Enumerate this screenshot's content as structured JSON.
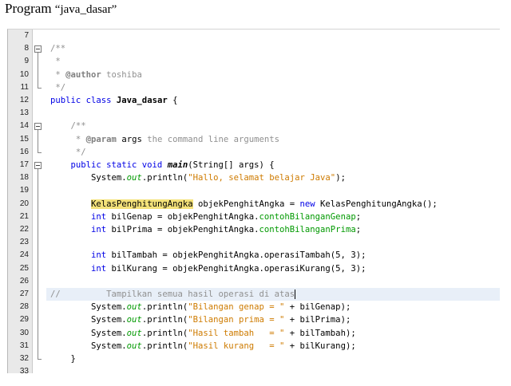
{
  "document": {
    "title_prefix": "Program",
    "title_quoted": "“java_dasar”"
  },
  "editor": {
    "lines": [
      {
        "num": "7",
        "parts": []
      },
      {
        "num": "8",
        "fold": "open",
        "parts": [
          {
            "t": "/**",
            "c": "c"
          }
        ]
      },
      {
        "num": "9",
        "parts": [
          {
            "t": " *",
            "c": "c"
          }
        ]
      },
      {
        "num": "10",
        "parts": [
          {
            "t": " * ",
            "c": "c"
          },
          {
            "t": "@author",
            "c": "ctag"
          },
          {
            "t": " toshiba",
            "c": "c"
          }
        ]
      },
      {
        "num": "11",
        "fold": "end",
        "parts": [
          {
            "t": " */",
            "c": "c"
          }
        ]
      },
      {
        "num": "12",
        "parts": [
          {
            "t": "public class ",
            "c": "kw"
          },
          {
            "t": "Java_dasar",
            "c": "cls"
          },
          {
            "t": " {",
            "c": ""
          }
        ]
      },
      {
        "num": "13",
        "parts": []
      },
      {
        "num": "14",
        "fold": "open",
        "parts": [
          {
            "t": "    /**",
            "c": "c"
          }
        ]
      },
      {
        "num": "15",
        "parts": [
          {
            "t": "     * ",
            "c": "c"
          },
          {
            "t": "@param",
            "c": "ctag"
          },
          {
            "t": " args",
            "c": ""
          },
          {
            "t": " the command line arguments",
            "c": "c"
          }
        ]
      },
      {
        "num": "16",
        "fold": "end",
        "parts": [
          {
            "t": "     */",
            "c": "c"
          }
        ]
      },
      {
        "num": "17",
        "fold": "open",
        "parts": [
          {
            "t": "    public static void ",
            "c": "kw"
          },
          {
            "t": "main",
            "c": "mth"
          },
          {
            "t": "(String[] args) {",
            "c": ""
          }
        ]
      },
      {
        "num": "18",
        "parts": [
          {
            "t": "        System.",
            "c": ""
          },
          {
            "t": "out",
            "c": "fld"
          },
          {
            "t": ".println(",
            "c": ""
          },
          {
            "t": "\"Hallo, selamat belajar Java\"",
            "c": "str"
          },
          {
            "t": ");",
            "c": ""
          }
        ]
      },
      {
        "num": "19",
        "parts": []
      },
      {
        "num": "20",
        "parts": [
          {
            "t": "        ",
            "c": ""
          },
          {
            "t": "KelasPenghitungAngka",
            "c": "mark"
          },
          {
            "t": " objekPenghitAngka = ",
            "c": ""
          },
          {
            "t": "new",
            "c": "kw"
          },
          {
            "t": " KelasPenghitungAngka();",
            "c": ""
          }
        ]
      },
      {
        "num": "21",
        "parts": [
          {
            "t": "        ",
            "c": ""
          },
          {
            "t": "int",
            "c": "kw"
          },
          {
            "t": " bilGenap = objekPenghitAngka.",
            "c": ""
          },
          {
            "t": "contohBilanganGenap",
            "c": "mcall"
          },
          {
            "t": ";",
            "c": ""
          }
        ]
      },
      {
        "num": "22",
        "parts": [
          {
            "t": "        ",
            "c": ""
          },
          {
            "t": "int",
            "c": "kw"
          },
          {
            "t": " bilPrima = objekPenghitAngka.",
            "c": ""
          },
          {
            "t": "contohBilanganPrima",
            "c": "mcall"
          },
          {
            "t": ";",
            "c": ""
          }
        ]
      },
      {
        "num": "23",
        "parts": []
      },
      {
        "num": "24",
        "parts": [
          {
            "t": "        ",
            "c": ""
          },
          {
            "t": "int",
            "c": "kw"
          },
          {
            "t": " bilTambah = objekPenghitAngka.operasiTambah(5, 3);",
            "c": ""
          }
        ]
      },
      {
        "num": "25",
        "parts": [
          {
            "t": "        ",
            "c": ""
          },
          {
            "t": "int",
            "c": "kw"
          },
          {
            "t": " bilKurang = objekPenghitAngka.operasiKurang(5, 3);",
            "c": ""
          }
        ]
      },
      {
        "num": "26",
        "parts": []
      },
      {
        "num": "27",
        "current": true,
        "parts": [
          {
            "t": "//         Tampilkan semua hasil operasi di atas",
            "c": "c"
          },
          {
            "t": "",
            "c": "caret"
          }
        ]
      },
      {
        "num": "28",
        "parts": [
          {
            "t": "        System.",
            "c": ""
          },
          {
            "t": "out",
            "c": "fld"
          },
          {
            "t": ".println(",
            "c": ""
          },
          {
            "t": "\"Bilangan genap = \"",
            "c": "str"
          },
          {
            "t": " + bilGenap);",
            "c": ""
          }
        ]
      },
      {
        "num": "29",
        "parts": [
          {
            "t": "        System.",
            "c": ""
          },
          {
            "t": "out",
            "c": "fld"
          },
          {
            "t": ".println(",
            "c": ""
          },
          {
            "t": "\"Bilangan prima = \"",
            "c": "str"
          },
          {
            "t": " + bilPrima);",
            "c": ""
          }
        ]
      },
      {
        "num": "30",
        "parts": [
          {
            "t": "        System.",
            "c": ""
          },
          {
            "t": "out",
            "c": "fld"
          },
          {
            "t": ".println(",
            "c": ""
          },
          {
            "t": "\"Hasil tambah   = \"",
            "c": "str"
          },
          {
            "t": " + bilTambah);",
            "c": ""
          }
        ]
      },
      {
        "num": "31",
        "parts": [
          {
            "t": "        System.",
            "c": ""
          },
          {
            "t": "out",
            "c": "fld"
          },
          {
            "t": ".println(",
            "c": ""
          },
          {
            "t": "\"Hasil kurang   = \"",
            "c": "str"
          },
          {
            "t": " + bilKurang);",
            "c": ""
          }
        ]
      },
      {
        "num": "32",
        "fold": "end",
        "parts": [
          {
            "t": "    }",
            "c": ""
          }
        ]
      },
      {
        "num": "33",
        "parts": []
      }
    ]
  }
}
